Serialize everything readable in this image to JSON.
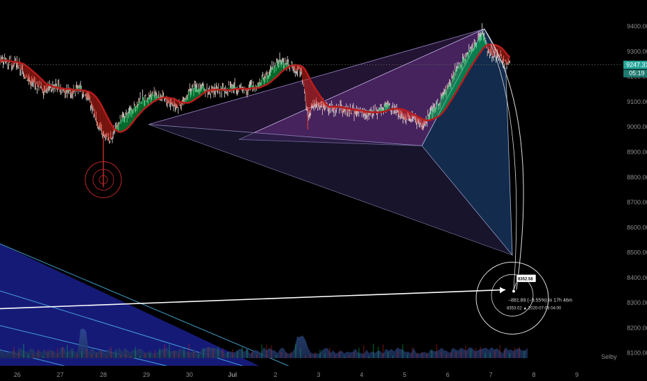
{
  "chart_data": {
    "type": "line",
    "series": [],
    "ylim": [
      8080,
      9450
    ],
    "y_ticks": [
      8100,
      8200,
      8300,
      8400,
      8500,
      8600,
      8700,
      8800,
      8900,
      9000,
      9100,
      9200,
      9300,
      9400
    ],
    "x_ticks": [
      "26",
      "27",
      "28",
      "29",
      "30",
      "Jul",
      "2",
      "3",
      "4",
      "5",
      "6",
      "7",
      "8",
      "9"
    ],
    "x_tick_values": [
      0,
      1,
      2,
      3,
      4,
      5,
      6,
      7,
      8,
      9,
      10,
      11,
      12,
      13
    ],
    "xlim": [
      -0.4,
      13.5
    ],
    "price_path": [
      [
        -0.4,
        9270
      ],
      [
        0.0,
        9250
      ],
      [
        0.3,
        9180
      ],
      [
        0.6,
        9150
      ],
      [
        0.9,
        9160
      ],
      [
        1.2,
        9140
      ],
      [
        1.5,
        9150
      ],
      [
        1.7,
        9100
      ],
      [
        1.85,
        9020
      ],
      [
        2.0,
        8960
      ],
      [
        2.15,
        8950
      ],
      [
        2.3,
        9000
      ],
      [
        2.6,
        9060
      ],
      [
        2.9,
        9110
      ],
      [
        3.2,
        9130
      ],
      [
        3.5,
        9100
      ],
      [
        3.8,
        9080
      ],
      [
        4.0,
        9140
      ],
      [
        4.2,
        9160
      ],
      [
        4.5,
        9140
      ],
      [
        4.8,
        9150
      ],
      [
        5.0,
        9160
      ],
      [
        5.3,
        9150
      ],
      [
        5.6,
        9170
      ],
      [
        5.9,
        9230
      ],
      [
        6.1,
        9260
      ],
      [
        6.4,
        9240
      ],
      [
        6.6,
        9220
      ],
      [
        6.75,
        9050
      ],
      [
        6.9,
        9090
      ],
      [
        7.2,
        9080
      ],
      [
        7.5,
        9070
      ],
      [
        7.8,
        9060
      ],
      [
        8.1,
        9050
      ],
      [
        8.3,
        9060
      ],
      [
        8.6,
        9090
      ],
      [
        8.8,
        9060
      ],
      [
        9.0,
        9040
      ],
      [
        9.2,
        9040
      ],
      [
        9.4,
        9000
      ],
      [
        9.6,
        9050
      ],
      [
        9.8,
        9100
      ],
      [
        10.0,
        9150
      ],
      [
        10.2,
        9230
      ],
      [
        10.4,
        9280
      ],
      [
        10.6,
        9320
      ],
      [
        10.8,
        9380
      ],
      [
        10.95,
        9300
      ],
      [
        11.1,
        9290
      ],
      [
        11.3,
        9260
      ],
      [
        11.45,
        9247
      ]
    ],
    "annotations": {
      "price_label": "9247.31",
      "countdown": "05:19",
      "target_label": "8352.58",
      "measure_text": "−881.89 (−9.55%) in 17h 46m",
      "measure_date": "8353.02 ▲ 2020-07-08 04:00"
    },
    "watermark": "Selby"
  },
  "colors": {
    "background": "#000000",
    "up": "#00c853",
    "down": "#e0261b",
    "ma": "#b71c1c",
    "accent": "#26a69a",
    "pattern_purple": "#6a3d9a",
    "pattern_blue": "#1a3a66"
  }
}
